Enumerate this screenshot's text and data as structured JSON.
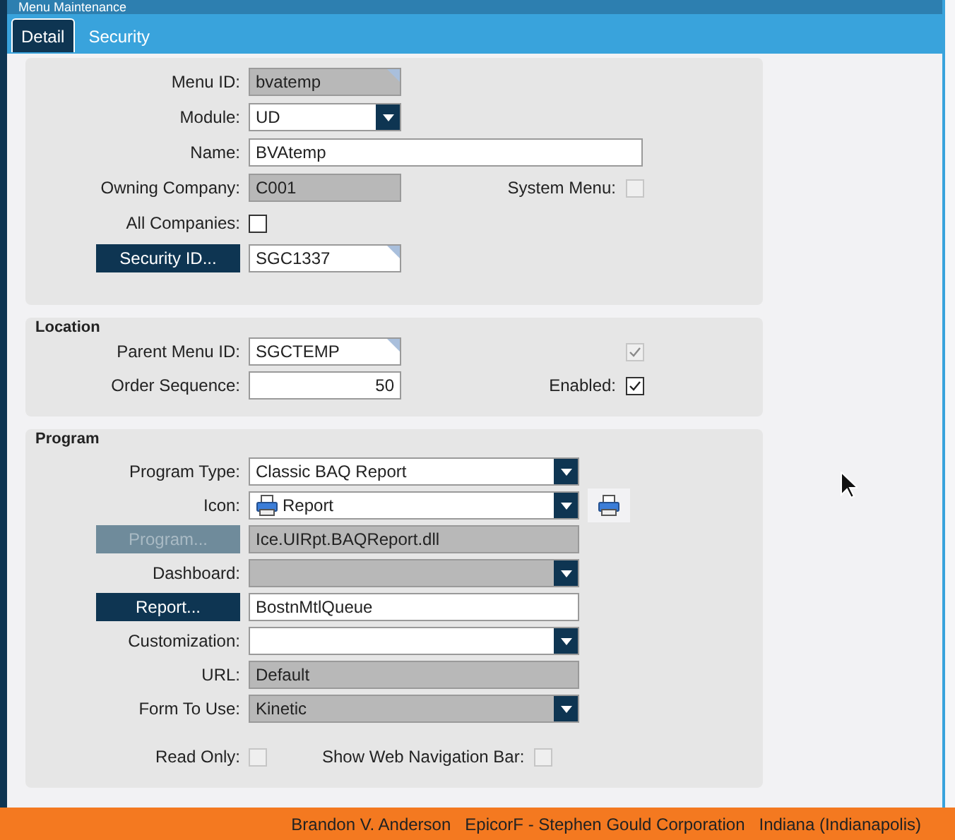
{
  "window": {
    "title": "Menu Maintenance"
  },
  "tabs": [
    {
      "label": "Detail",
      "selected": true
    },
    {
      "label": "Security",
      "selected": false
    }
  ],
  "sections": [
    {
      "rows": [
        {
          "label": "Menu ID:",
          "field": {
            "kind": "text",
            "value": "bvatemp",
            "readonly": true,
            "lookup": true
          }
        },
        {
          "label": "Module:",
          "field": {
            "kind": "dropdown",
            "value": "UD",
            "readonly": false
          }
        },
        {
          "label": "Name:",
          "field": {
            "kind": "text",
            "value": "BVAtemp",
            "readonly": false,
            "lookup": false
          }
        },
        {
          "label": "Owning Company:",
          "field": {
            "kind": "text",
            "value": "C001",
            "readonly": true,
            "lookup": false
          },
          "right": {
            "label": "System Menu:",
            "checked": false,
            "disabled": true
          }
        },
        {
          "label": "All Companies:",
          "field": {
            "kind": "checkbox",
            "checked": false,
            "disabled": false
          }
        },
        {
          "button": {
            "label": "Security ID...",
            "disabled": false
          },
          "field": {
            "kind": "text",
            "value": "SGC1337",
            "readonly": false,
            "lookup": true
          }
        }
      ]
    },
    {
      "title": "Location",
      "rows": [
        {
          "label": "Parent Menu ID:",
          "field": {
            "kind": "text",
            "value": "SGCTEMP",
            "readonly": false,
            "lookup": true
          },
          "right": {
            "checked": true,
            "disabled": true
          }
        },
        {
          "label": "Order Sequence:",
          "field": {
            "kind": "number",
            "value": "50",
            "readonly": false,
            "lookup": false
          },
          "right": {
            "label": "Enabled:",
            "checked": true,
            "disabled": false
          }
        }
      ]
    },
    {
      "title": "Program",
      "rows": [
        {
          "label": "Program Type:",
          "field": {
            "kind": "dropdown",
            "value": "Classic BAQ Report",
            "readonly": false
          }
        },
        {
          "label": "Icon:",
          "field": {
            "kind": "icon-dropdown",
            "value": "Report",
            "readonly": false
          }
        },
        {
          "button": {
            "label": "Program...",
            "disabled": true
          },
          "field": {
            "kind": "text",
            "value": "Ice.UIRpt.BAQReport.dll",
            "readonly": true,
            "lookup": false
          }
        },
        {
          "label": "Dashboard:",
          "field": {
            "kind": "dropdown",
            "readonly": true
          }
        },
        {
          "button": {
            "label": "Report...",
            "disabled": false
          },
          "field": {
            "kind": "text",
            "value": "BostnMtlQueue",
            "readonly": false,
            "lookup": false
          }
        },
        {
          "label": "Customization:",
          "field": {
            "kind": "dropdown",
            "readonly": false
          }
        },
        {
          "label": "URL:",
          "field": {
            "kind": "text",
            "value": "Default",
            "readonly": true,
            "lookup": false
          }
        },
        {
          "label": "Form To Use:",
          "field": {
            "kind": "dropdown",
            "value": "Kinetic",
            "readonly": true
          }
        },
        {
          "label": "Read Only:",
          "field": {
            "kind": "checkbox",
            "checked": false,
            "disabled": true
          },
          "right": {
            "label": "Show Web Navigation Bar:",
            "checked": false,
            "disabled": true
          }
        }
      ]
    }
  ],
  "status_bar": [
    "Brandon V. Anderson",
    "EpicorF - Stephen Gould Corporation",
    "Indiana (Indianapolis)"
  ]
}
